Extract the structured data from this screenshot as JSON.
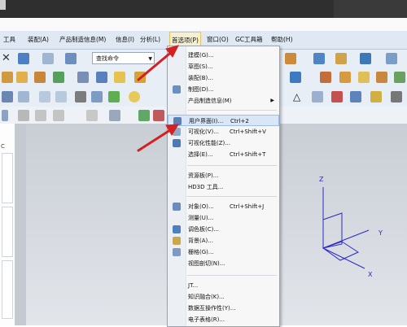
{
  "titlebar": {
    "text": ""
  },
  "menubar": {
    "items": [
      {
        "label": "工具"
      },
      {
        "label": "装配(A)"
      },
      {
        "label": "产品制造信息(M)"
      },
      {
        "label": "信息(I)"
      },
      {
        "label": "分析(L)"
      },
      {
        "label": "首选项(P)",
        "active": true
      },
      {
        "label": "窗口(O)"
      },
      {
        "label": "GC工具箱"
      },
      {
        "label": "帮助(H)"
      }
    ]
  },
  "toolbar": {
    "command_search": {
      "value": "查找命令"
    }
  },
  "left_panel": {
    "label": "C"
  },
  "preferences_menu": {
    "items": [
      {
        "label": "建模(G)...",
        "shortcut": "",
        "submenu": false
      },
      {
        "label": "草图(S)...",
        "shortcut": "",
        "submenu": false
      },
      {
        "label": "装配(B)...",
        "shortcut": "",
        "submenu": false
      },
      {
        "label": "制图(D)...",
        "shortcut": "",
        "submenu": false
      },
      {
        "label": "产品制造信息(M)",
        "shortcut": "",
        "submenu": true
      },
      {
        "label": "用户界面(I)...",
        "shortcut": "Ctrl+2",
        "submenu": false,
        "highlighted": true
      },
      {
        "label": "可视化(V)...",
        "shortcut": "Ctrl+Shift+V",
        "submenu": false
      },
      {
        "label": "可视化性能(Z)...",
        "shortcut": "",
        "submenu": false
      },
      {
        "label": "选择(E)...",
        "shortcut": "Ctrl+Shift+T",
        "submenu": false
      },
      {
        "label": "资源板(P)...",
        "shortcut": "",
        "submenu": false
      },
      {
        "label": "HD3D 工具...",
        "shortcut": "",
        "submenu": false
      },
      {
        "label": "对象(O)...",
        "shortcut": "Ctrl+Shift+J",
        "submenu": false
      },
      {
        "label": "测量(U)...",
        "shortcut": "",
        "submenu": false
      },
      {
        "label": "调色板(C)...",
        "shortcut": "",
        "submenu": false
      },
      {
        "label": "背景(A)...",
        "shortcut": "",
        "submenu": false
      },
      {
        "label": "栅格(G)...",
        "shortcut": "",
        "submenu": false
      },
      {
        "label": "视图剖切(N)...",
        "shortcut": "",
        "submenu": false
      },
      {
        "label": "JT...",
        "shortcut": "",
        "submenu": false
      },
      {
        "label": "知识融合(K)...",
        "shortcut": "",
        "submenu": false
      },
      {
        "label": "数据互操作性(Y)...",
        "shortcut": "",
        "submenu": false
      },
      {
        "label": "电子表格(R)...",
        "shortcut": "",
        "submenu": false
      }
    ]
  },
  "viewport": {
    "axis_labels": {
      "x": "X",
      "y": "Y",
      "z": "Z"
    }
  },
  "colors": {
    "annotation_arrow": "#d42020",
    "axes": "#2a2ac8",
    "menu_highlight": "#d8e6f7"
  }
}
